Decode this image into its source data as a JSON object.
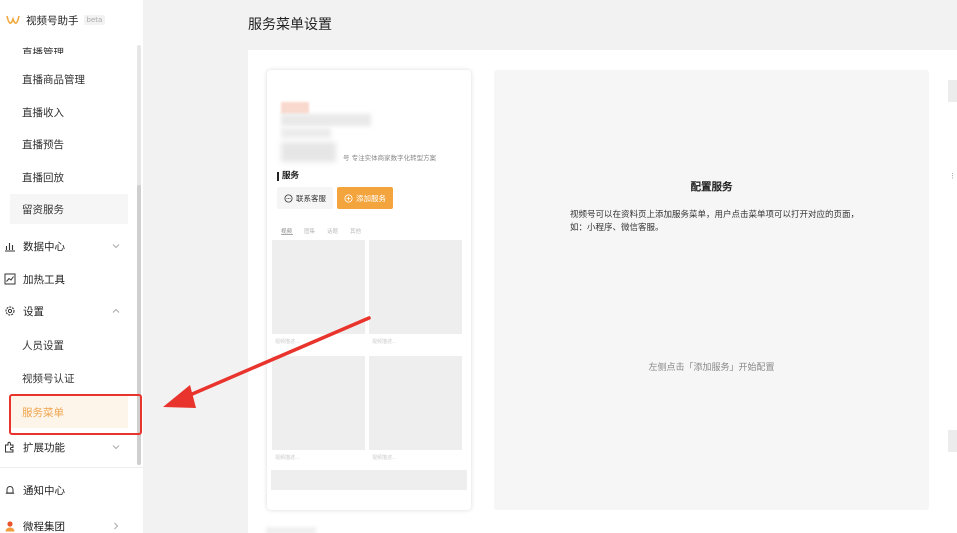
{
  "brand": {
    "name": "视频号助手",
    "badge": "beta"
  },
  "sidebar": {
    "clipped_item": "直播管理",
    "sub_items_top": [
      "直播商品管理",
      "直播收入",
      "直播预告",
      "直播回放",
      "留资服务"
    ],
    "groups": [
      {
        "label": "数据中心",
        "icon": "bar-chart-icon",
        "expanded": false
      },
      {
        "label": "加热工具",
        "icon": "trend-chart-icon"
      },
      {
        "label": "设置",
        "icon": "gear-icon",
        "expanded": true
      }
    ],
    "settings_items": [
      "人员设置",
      "视频号认证",
      "服务菜单"
    ],
    "active_item": "服务菜单",
    "more_group": {
      "label": "扩展功能",
      "icon": "puzzle-icon",
      "expanded": false
    },
    "footer_items": [
      {
        "label": "通知中心",
        "icon": "bell-icon"
      },
      {
        "label": "微程集团",
        "icon": "avatar-icon"
      }
    ]
  },
  "main": {
    "title": "服务菜单设置",
    "preview": {
      "intro": "号 专注实体商家数字化转型方案",
      "section_label": "服务",
      "contact_button": "联系客服",
      "add_button": "添加服务",
      "tabs": [
        "视频",
        "图集",
        "话题",
        "其他"
      ],
      "tile_caption": "视频描述..."
    },
    "config": {
      "title": "配置服务",
      "description": "视频号可以在资料页上添加服务菜单，用户点击菜单项可以打开对应的页面，如：小程序、微信客服。",
      "hint": "左侧点击「添加服务」开始配置"
    }
  },
  "colors": {
    "accent": "#f4a43c",
    "annotation": "#e8342c",
    "active_text": "#f0a44c"
  }
}
